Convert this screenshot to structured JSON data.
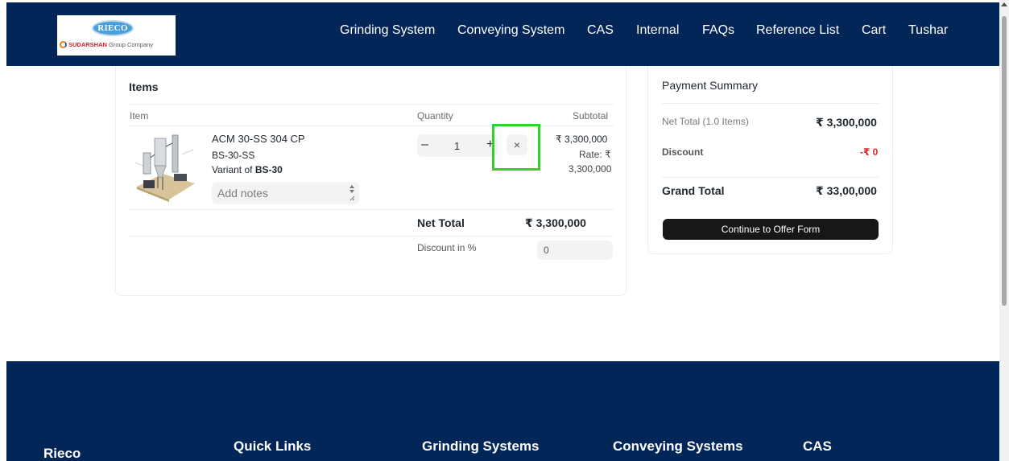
{
  "header": {
    "logo_text": "RIECO",
    "logo_brand": "SUDARSHAN",
    "logo_tagline": "Group Company",
    "nav": [
      "Grinding System",
      "Conveying System",
      "CAS",
      "Internal",
      "FAQs",
      "Reference List",
      "Cart",
      "Tushar"
    ]
  },
  "items": {
    "title": "Items",
    "col_item": "Item",
    "col_quantity": "Quantity",
    "col_subtotal": "Subtotal",
    "product": {
      "name": "ACM 30-SS 304 CP",
      "code": "BS-30-SS",
      "variant_prefix": "Variant of ",
      "variant": "BS-30",
      "quantity": "1",
      "minus": "–",
      "plus": "+",
      "remove": "×",
      "subtotal": "₹ 3,300,000",
      "rate_label": "Rate: ₹",
      "rate_value": "3,300,000",
      "notes_placeholder": "Add notes"
    },
    "net_total_label": "Net Total",
    "net_total_value": "₹ 3,300,000",
    "discount_label": "Discount in %",
    "discount_value": "0"
  },
  "summary": {
    "title": "Payment Summary",
    "net_total_label": "Net Total (1.0 Items)",
    "net_total_value": "₹ 3,300,000",
    "discount_label": "Discount",
    "discount_value": "-₹ 0",
    "grand_total_label": "Grand Total",
    "grand_total_value": "₹ 33,00,000",
    "button": "Continue to Offer Form"
  },
  "footer": {
    "headings": [
      "Rieco",
      "Quick Links",
      "Grinding Systems",
      "Conveying Systems",
      "CAS"
    ]
  },
  "colors": {
    "navy": "#032658",
    "highlight": "#2fd12f",
    "discount_red": "#e02424"
  }
}
